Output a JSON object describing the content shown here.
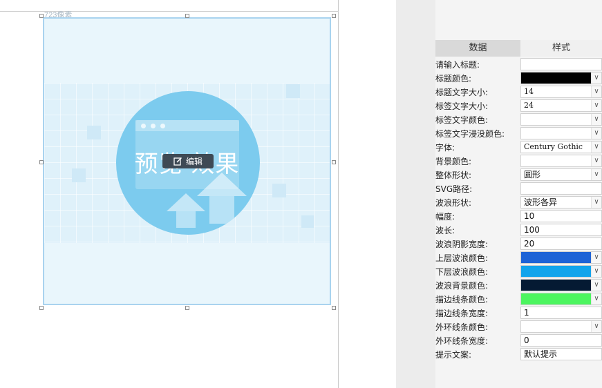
{
  "canvas": {
    "width_label": "723像素",
    "preview_text": "预览 ​效果",
    "edit_label": "编辑"
  },
  "panel": {
    "tabs": [
      "数据",
      "样式"
    ],
    "rows": [
      {
        "label": "请输入标题:",
        "type": "text",
        "value": ""
      },
      {
        "label": "标题颜色:",
        "type": "color",
        "color": "#000000"
      },
      {
        "label": "标题文字大小:",
        "type": "select",
        "value": "14"
      },
      {
        "label": "标签文字大小:",
        "type": "select",
        "value": "24"
      },
      {
        "label": "标签文字颜色:",
        "type": "select",
        "value": ""
      },
      {
        "label": "标签文字浸没颜色:",
        "type": "select",
        "value": ""
      },
      {
        "label": "字体:",
        "type": "select",
        "value": "Century Gothic"
      },
      {
        "label": "背景颜色:",
        "type": "select",
        "value": ""
      },
      {
        "label": "整体形状:",
        "type": "select",
        "value": "圆形"
      },
      {
        "label": "SVG路径:",
        "type": "text",
        "value": ""
      },
      {
        "label": "波浪形状:",
        "type": "select",
        "value": "波形各异"
      },
      {
        "label": "幅度:",
        "type": "text",
        "value": "10"
      },
      {
        "label": "波长:",
        "type": "text",
        "value": "100"
      },
      {
        "label": "波浪阴影宽度:",
        "type": "text",
        "value": "20"
      },
      {
        "label": "上层波浪颜色:",
        "type": "color",
        "color": "#1e63d6"
      },
      {
        "label": "下层波浪颜色:",
        "type": "color",
        "color": "#12a4ec"
      },
      {
        "label": "波浪背景颜色:",
        "type": "color",
        "color": "#051a33"
      },
      {
        "label": "描边线条颜色:",
        "type": "color",
        "color": "#4cf55f"
      },
      {
        "label": "描边线条宽度:",
        "type": "text",
        "value": "1"
      },
      {
        "label": "外环线条颜色:",
        "type": "select",
        "value": ""
      },
      {
        "label": "外环线条宽度:",
        "type": "text",
        "value": "0"
      },
      {
        "label": "提示文案:",
        "type": "text",
        "value": "默认提示"
      }
    ]
  },
  "icons": {
    "edit": "edit-icon",
    "chevron": "chevron-down-icon"
  }
}
